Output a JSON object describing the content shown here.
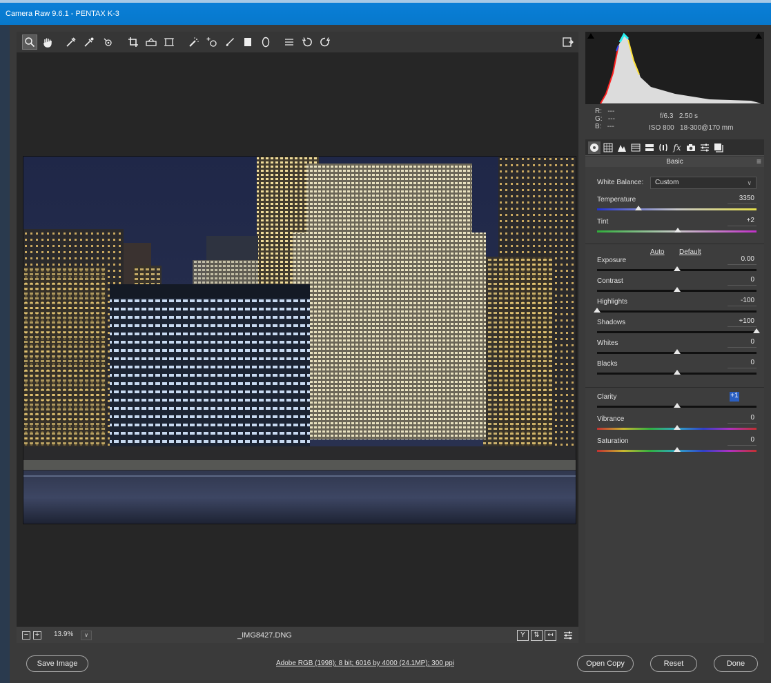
{
  "window": {
    "title": "Camera Raw 9.6.1  -  PENTAX K-3"
  },
  "toolbar": {
    "tools": [
      "zoom-icon",
      "hand-icon",
      "white-balance-icon",
      "color-sampler-icon",
      "targeted-adjustment-icon",
      "crop-icon",
      "straighten-icon",
      "transform-icon",
      "spot-removal-icon",
      "red-eye-icon",
      "adjustment-brush-icon",
      "graduated-filter-icon",
      "radial-filter-icon",
      "preferences-icon",
      "rotate-left-icon",
      "rotate-right-icon"
    ],
    "active_tool": "zoom-icon"
  },
  "histogram": {
    "r_label": "R:",
    "r_value": "---",
    "g_label": "G:",
    "g_value": "---",
    "b_label": "B:",
    "b_value": "---",
    "aperture": "f/6.3",
    "shutter": "2.50 s",
    "iso": "ISO 800",
    "lens": "18-300@170 mm"
  },
  "panel": {
    "title": "Basic",
    "tabs": [
      "basic-tab-icon",
      "tone-curve-tab-icon",
      "detail-tab-icon",
      "hsl-tab-icon",
      "split-toning-tab-icon",
      "lens-tab-icon",
      "effects-tab-icon",
      "camera-calibration-tab-icon",
      "presets-tab-icon",
      "snapshots-tab-icon"
    ],
    "white_balance_label": "White Balance:",
    "white_balance_value": "Custom",
    "auto_label": "Auto",
    "default_label": "Default",
    "sliders": [
      {
        "label": "Temperature",
        "value": "3350",
        "pos": 0.26
      },
      {
        "label": "Tint",
        "value": "+2",
        "pos": 0.505
      },
      {
        "label": "Exposure",
        "value": "0.00",
        "pos": 0.5
      },
      {
        "label": "Contrast",
        "value": "0",
        "pos": 0.5
      },
      {
        "label": "Highlights",
        "value": "-100",
        "pos": 0.0
      },
      {
        "label": "Shadows",
        "value": "+100",
        "pos": 1.0
      },
      {
        "label": "Whites",
        "value": "0",
        "pos": 0.5
      },
      {
        "label": "Blacks",
        "value": "0",
        "pos": 0.5
      },
      {
        "label": "Clarity",
        "value": "+1",
        "pos": 0.5
      },
      {
        "label": "Vibrance",
        "value": "0",
        "pos": 0.5
      },
      {
        "label": "Saturation",
        "value": "0",
        "pos": 0.5
      }
    ]
  },
  "status": {
    "zoom": "13.9%",
    "filename": "_IMG8427.DNG"
  },
  "bottom": {
    "save_label": "Save Image",
    "workflow_info": "Adobe RGB (1998); 8 bit; 6016 by 4000 (24.1MP); 300 ppi",
    "open_label": "Open Copy",
    "reset_label": "Reset",
    "done_label": "Done"
  },
  "colors": {
    "title_bar": "#0778cc",
    "panel_bg": "#3d3d3d",
    "canvas_bg": "#262626",
    "selected_value": "#2a5fc2"
  }
}
